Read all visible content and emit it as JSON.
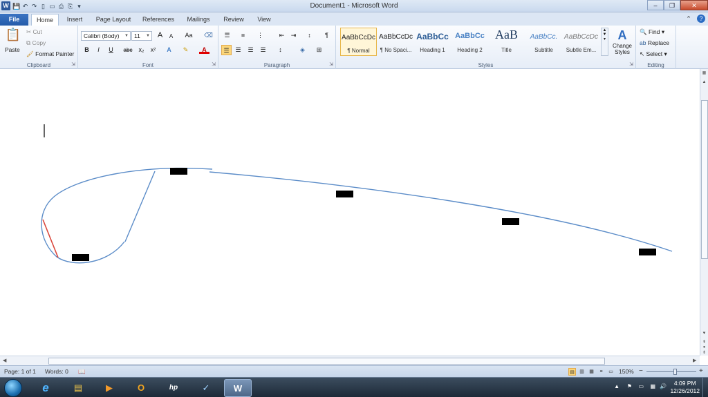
{
  "window": {
    "title": "Document1 - Microsoft Word",
    "app_icon": "W",
    "min_glyph": "–",
    "max_glyph": "❐",
    "close_glyph": "✕",
    "restore_ribbon_glyph": "⌃"
  },
  "tabs": [
    {
      "label": "File"
    },
    {
      "label": "Home"
    },
    {
      "label": "Insert"
    },
    {
      "label": "Page Layout"
    },
    {
      "label": "References"
    },
    {
      "label": "Mailings"
    },
    {
      "label": "Review"
    },
    {
      "label": "View"
    }
  ],
  "ribbon": {
    "clipboard": {
      "label": "Clipboard",
      "paste": "Paste",
      "cut": "Cut",
      "copy": "Copy",
      "format_painter": "Format Painter"
    },
    "font": {
      "label": "Font",
      "family": "Calibri (Body)",
      "size": "11",
      "grow": "A",
      "shrink": "A",
      "change_case": "Aa",
      "bold": "B",
      "italic": "I",
      "underline": "U",
      "strike": "abc",
      "subscript": "x₂",
      "superscript": "x²"
    },
    "paragraph": {
      "label": "Paragraph",
      "pilcrow": "¶"
    },
    "styles": {
      "label": "Styles",
      "items": [
        {
          "preview": "AaBbCcDc",
          "name": "¶ Normal",
          "selected": true
        },
        {
          "preview": "AaBbCcDc",
          "name": "¶ No Spaci..."
        },
        {
          "preview": "AaBbCc",
          "name": "Heading 1"
        },
        {
          "preview": "AaBbCc",
          "name": "Heading 2"
        },
        {
          "preview": "AaB",
          "name": "Title"
        },
        {
          "preview": "AaBbCc.",
          "name": "Subtitle"
        },
        {
          "preview": "AaBbCcDc",
          "name": "Subtle Em..."
        }
      ],
      "change_styles": "Change Styles"
    },
    "editing": {
      "label": "Editing",
      "find": "Find",
      "replace": "Replace",
      "select": "Select"
    }
  },
  "document": {
    "boxes": 5
  },
  "status": {
    "page": "Page: 1 of 1",
    "words": "Words: 0",
    "zoom": "150%",
    "zoom_minus": "−",
    "zoom_plus": "+"
  },
  "taskbar": {
    "time": "4:09 PM",
    "date": "12/26/2012",
    "apps": [
      {
        "name": "internet-explorer",
        "glyph": "e"
      },
      {
        "name": "file-explorer",
        "glyph": "▤"
      },
      {
        "name": "media-player",
        "glyph": "▶"
      },
      {
        "name": "outlook",
        "glyph": "O"
      },
      {
        "name": "hp",
        "glyph": "hp"
      },
      {
        "name": "checkmark-app",
        "glyph": "✓"
      },
      {
        "name": "word",
        "glyph": "W"
      }
    ]
  },
  "colors": {
    "file_tab": "#2a62b0",
    "curve": "#5b8cc8",
    "red_line": "#d9463b"
  }
}
